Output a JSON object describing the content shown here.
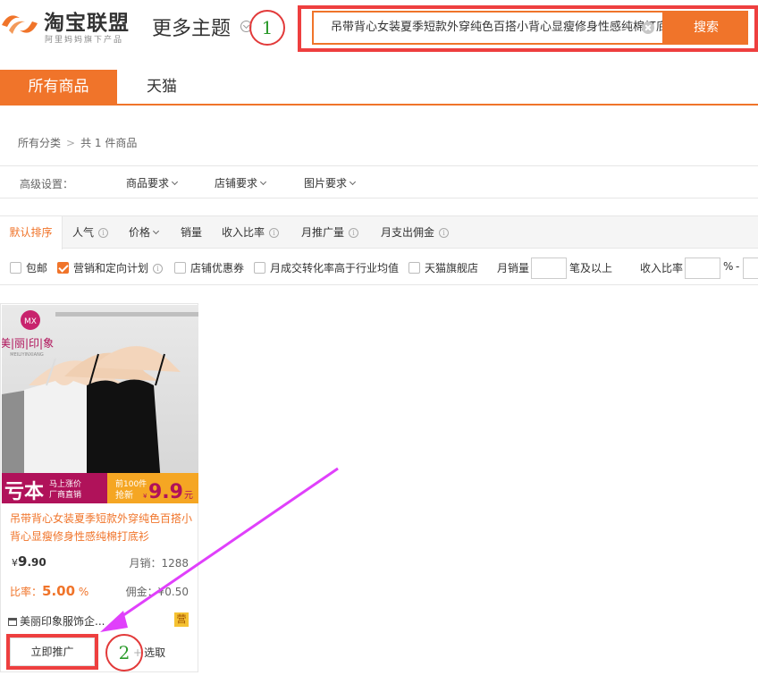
{
  "header": {
    "logo_title": "淘宝联盟",
    "logo_subtitle": "阿里妈妈旗下产品",
    "more_themes": "更多主题",
    "search_value": "吊带背心女装夏季短款外穿纯色百搭小背心显瘦修身性感纯棉打底衫",
    "search_button": "搜索"
  },
  "annotations": {
    "mark1": "1",
    "mark2": "2"
  },
  "tabs": [
    {
      "label": "所有商品",
      "active": true
    },
    {
      "label": "天猫",
      "active": false
    }
  ],
  "breadcrumb": {
    "root": "所有分类",
    "sep": ">",
    "count": "共 1 件商品"
  },
  "advanced": {
    "label": "高级设置：",
    "items": [
      "商品要求",
      "店铺要求",
      "图片要求"
    ]
  },
  "sort": {
    "items": [
      "默认排序",
      "人气",
      "价格",
      "销量",
      "收入比率",
      "月推广量",
      "月支出佣金"
    ]
  },
  "filters": {
    "checkboxes": [
      {
        "label": "包邮",
        "checked": false
      },
      {
        "label": "营销和定向计划",
        "checked": true
      },
      {
        "label": "店铺优惠券",
        "checked": false
      },
      {
        "label": "月成交转化率高于行业均值",
        "checked": false
      },
      {
        "label": "天猫旗舰店",
        "checked": false
      }
    ],
    "monthly_sales_label": "月销量",
    "monthly_sales_suffix": "笔及以上",
    "income_ratio_label": "收入比率",
    "percent_sign": "%",
    "dash": "-"
  },
  "product": {
    "brand_cn": "美|丽|印|象",
    "brand_en": "MEILIYINXIANG",
    "brand_badge": "MX",
    "banner_big": "亏本",
    "banner_small_1": "马上涨价",
    "banner_small_2": "厂商直销",
    "banner_first": "前100件",
    "banner_grab": "抢新",
    "banner_price": "9.9",
    "banner_price_prefix": "¥",
    "banner_unit": "元",
    "title": "吊带背心女装夏季短款外穿纯色百搭小背心显瘦修身性感纯棉打底衫",
    "price_symbol": "¥",
    "price_int": "9",
    "price_dec": ".90",
    "monthly_sales": "月销：1288",
    "rate_label": "比率：",
    "rate_value": "5.00",
    "rate_unit": "%",
    "commission": "佣金：¥0.50",
    "shop_name": "美丽印象服饰企...",
    "tag": "营",
    "promote_button": "立即推广",
    "select_button": "选取",
    "select_plus": "+"
  },
  "colors": {
    "accent": "#f0742a",
    "annotation_red": "#ee3f3f",
    "arrow_magenta": "#e040fb"
  }
}
